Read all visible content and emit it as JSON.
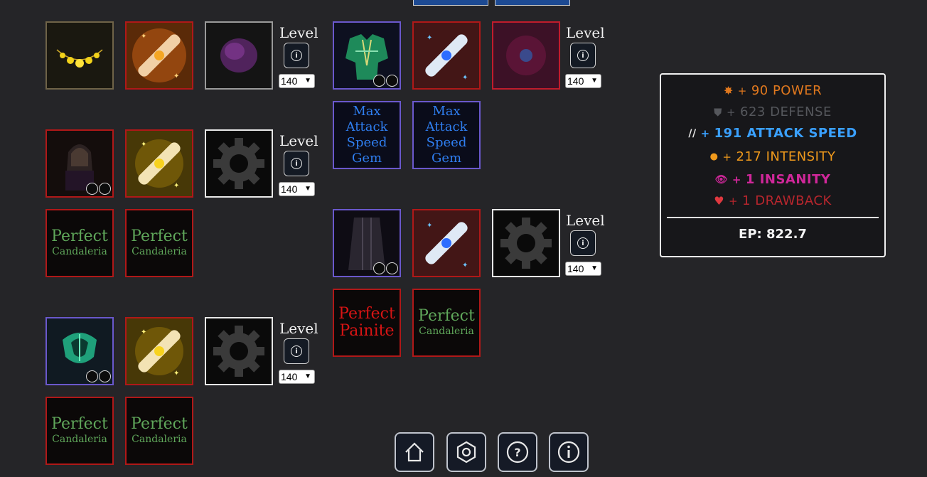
{
  "top_buttons": [
    "",
    ""
  ],
  "level_label": "Level",
  "info_glyph": "i",
  "level_value": "140",
  "gems": {
    "g1": [
      "Max",
      "Attack",
      "Speed",
      "Gem"
    ],
    "g2": [
      "Max",
      "Attack",
      "Speed",
      "Gem"
    ]
  },
  "materials": {
    "m1": {
      "line1": "Perfect",
      "line2": "Candaleria",
      "color": "green"
    },
    "m2": {
      "line1": "Perfect",
      "line2": "Candaleria",
      "color": "green"
    },
    "m3": {
      "line1": "Perfect",
      "line2": "Candaleria",
      "color": "green"
    },
    "m4": {
      "line1": "Perfect",
      "line2": "Candaleria",
      "color": "green"
    },
    "m5": {
      "line1": "Perfect",
      "line2": "Painite",
      "color": "red"
    },
    "m6": {
      "line1": "Perfect",
      "line2": "Candaleria",
      "color": "green"
    }
  },
  "stats": {
    "power": {
      "sign": "+",
      "text": "90 POWER",
      "color": "#e0781e",
      "icon": "star-burst-icon"
    },
    "defense": {
      "sign": "+",
      "text": "623 DEFENSE",
      "color": "#55575c",
      "icon": "shield-icon"
    },
    "attack_speed": {
      "sign": "+",
      "text": "191 ATTACK SPEED",
      "color": "#3aa0ff",
      "icon": "claw-icon"
    },
    "intensity": {
      "sign": "+",
      "text": "217 INTENSITY",
      "color": "#f09a1c",
      "icon": "fist-icon"
    },
    "insanity": {
      "sign": "+",
      "text": "1 INSANITY",
      "color": "#d0279a",
      "icon": "eye-icon"
    },
    "drawback": {
      "sign": "+",
      "text": "1 DRAWBACK",
      "color": "#b8262d",
      "icon": "broken-heart-icon"
    },
    "ep": "EP: 822.7"
  },
  "nav": [
    "home-icon",
    "settings-hex-icon",
    "help-icon",
    "info-icon"
  ]
}
